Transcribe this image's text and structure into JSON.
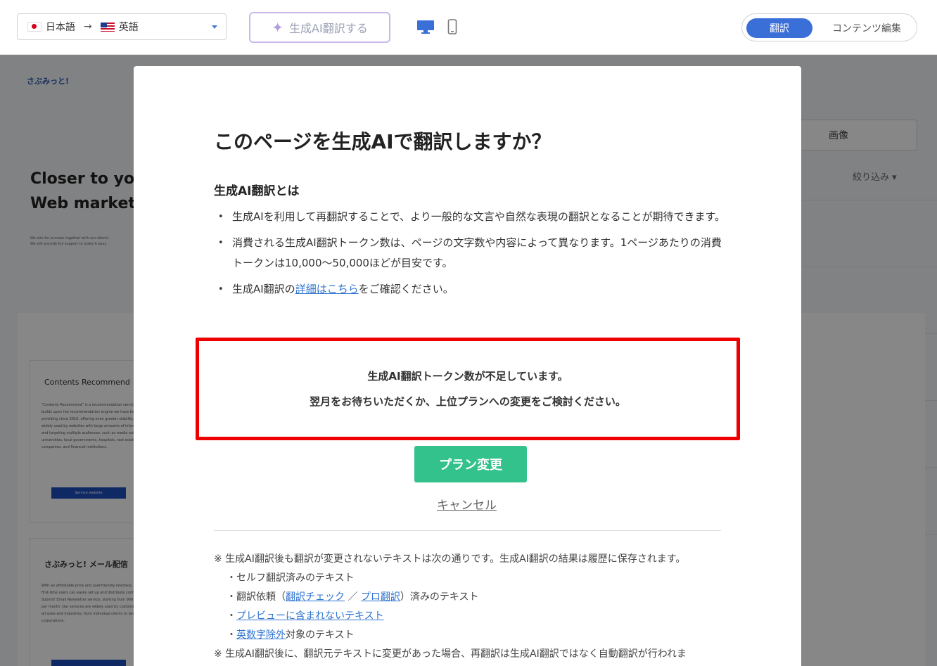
{
  "topbar": {
    "source_lang": "日本語",
    "arrow": "→",
    "target_lang": "英語",
    "ai_translate_label": "生成AI翻訳する",
    "mode_translate": "翻訳",
    "mode_content_edit": "コンテンツ編集"
  },
  "background": {
    "logo": "さぶみっと!",
    "hero_line1": "Closer to you",
    "hero_line2": "Web marketi",
    "small_line1": "We aim for success together with our clients",
    "small_line2": "We will provide full support to make it easy",
    "right_tab": "画像",
    "filter": "絞り込み ▾",
    "card1_title": "Contents Recommend",
    "card1_text": "\"Contents Recommend\" is a recommendation service that builds upon the recommendation engine we have been providing since 2010, offering even greater stability. It is widely used by websites with large amounts of information and targeting multiple audiences, such as media outlets, universities, local governments, hospitals, real estate companies, and financial institutions.",
    "card1_button": "Service website",
    "card2_title": "さぶみっと! メール配信",
    "card2_text": "With an affordable price and user-friendly interface, even first-time users can easily set up and distribute content! Submit! Email Newsletter service, starting from 900 yen per month. Our services are widely used by customers of all sizes and industries, from individual clients to large corporations."
  },
  "modal": {
    "title": "このページを生成AIで翻訳しますか？",
    "subtitle": "生成AI翻訳とは",
    "bullet1": "生成AIを利用して再翻訳することで、より一般的な文言や自然な表現の翻訳となることが期待できます。",
    "bullet2": "消費される生成AI翻訳トークン数は、ページの文字数や内容によって異なります。1ページあたりの消費トークンは10,000〜50,000ほどが目安です。",
    "bullet3_pre": "生成AI翻訳の",
    "bullet3_link": "詳細はこちら",
    "bullet3_post": "をご確認ください。",
    "warning_line1": "生成AI翻訳トークン数が不足しています。",
    "warning_line2": "翌月をお待ちいただくか、上位プランへの変更をご検討ください。",
    "plan_button": "プラン変更",
    "cancel": "キャンセル",
    "note1": "※ 生成AI翻訳後も翻訳が変更されないテキストは次の通りです。生成AI翻訳の結果は履歴に保存されます。",
    "note_self": "・セルフ翻訳済みのテキスト",
    "note_req_pre": "・翻訳依頼（",
    "note_req_link1": "翻訳チェック",
    "note_req_sep": " ／ ",
    "note_req_link2": "プロ翻訳",
    "note_req_post": "）済みのテキスト",
    "note_preview_pre": "・",
    "note_preview_link": "プレビューに含まれないテキスト",
    "note_excl_pre": "・",
    "note_excl_link": "英数字除外",
    "note_excl_post": "対象のテキスト",
    "note2": "※ 生成AI翻訳後に、翻訳元テキストに変更があった場合、再翻訳は生成AI翻訳ではなく自動翻訳が行われま"
  },
  "colors": {
    "accent_blue": "#3a6fd8",
    "plan_green": "#33c18c",
    "warning_red": "#ee0000",
    "link_blue": "#2f74d0"
  },
  "icons": [
    "japan-flag-icon",
    "us-flag-icon",
    "sparkle-icon",
    "desktop-icon",
    "mobile-icon",
    "chevron-down-icon"
  ]
}
